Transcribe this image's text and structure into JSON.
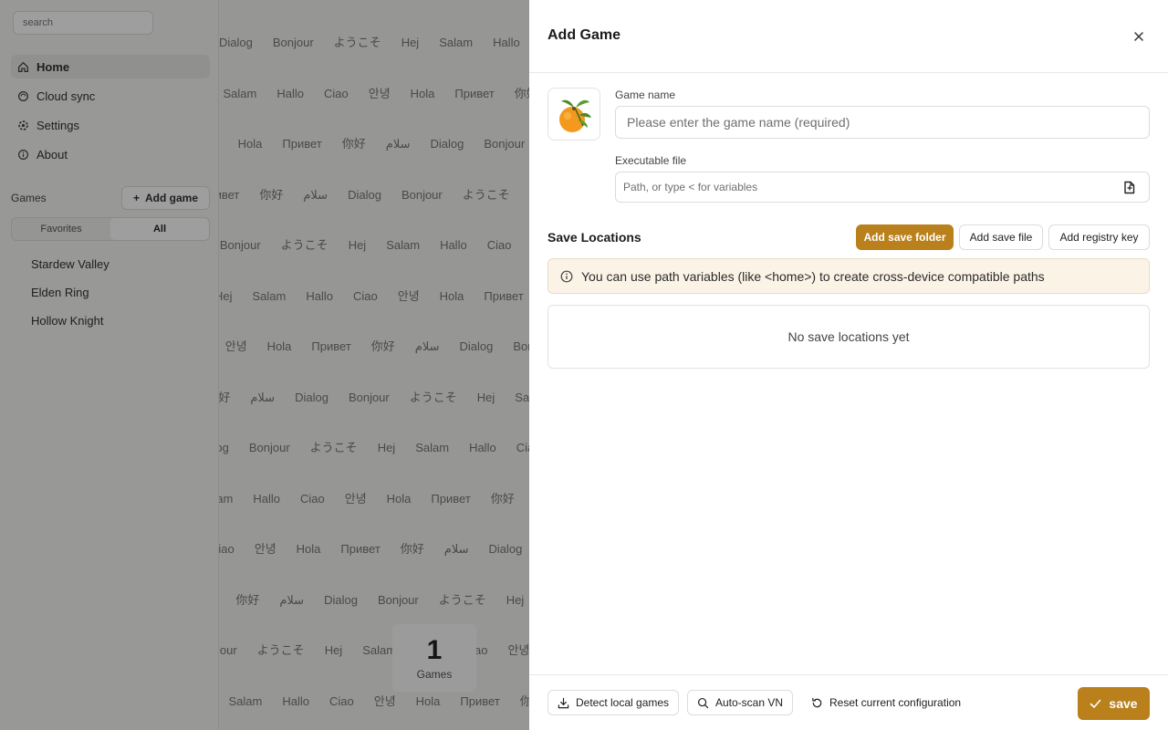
{
  "background": {
    "search_placeholder": "search",
    "nav": [
      {
        "label": "Home",
        "icon": "home-icon"
      },
      {
        "label": "Cloud sync",
        "icon": "cloud-icon"
      },
      {
        "label": "Settings",
        "icon": "gear-icon"
      },
      {
        "label": "About",
        "icon": "info-icon"
      }
    ],
    "games_title": "Games",
    "add_game_label": "Add game",
    "filter_tabs": [
      "Favorites",
      "All"
    ],
    "games": [
      "Stardew Valley",
      "Elden Ring",
      "Hollow Knight"
    ],
    "wall_words": [
      "Dialog",
      "Bonjour",
      "ようこそ",
      "Hej",
      "Salam",
      "Hallo",
      "Ciao",
      "안녕",
      "Hola",
      "Привет",
      "你好",
      "سلام"
    ],
    "counter": {
      "value": "1",
      "label": "Games"
    }
  },
  "dialog": {
    "title": "Add Game",
    "game_name": {
      "label": "Game name",
      "value": "",
      "placeholder": "Please enter the game name (required)"
    },
    "executable": {
      "label": "Executable file",
      "value": "",
      "placeholder": "Path, or type < for variables"
    },
    "save_locations": {
      "title": "Save Locations",
      "add_folder_label": "Add save folder",
      "add_file_label": "Add save file",
      "add_registry_label": "Add registry key",
      "info_text": "You can use path variables (like <home>) to create cross-device compatible paths",
      "empty_text": "No save locations yet"
    },
    "footer": {
      "detect_label": "Detect local games",
      "autoscan_label": "Auto-scan VN",
      "reset_label": "Reset current configuration",
      "save_label": "save"
    }
  },
  "colors": {
    "accent": "#b9801c",
    "info_bg": "#fbf3e6"
  }
}
